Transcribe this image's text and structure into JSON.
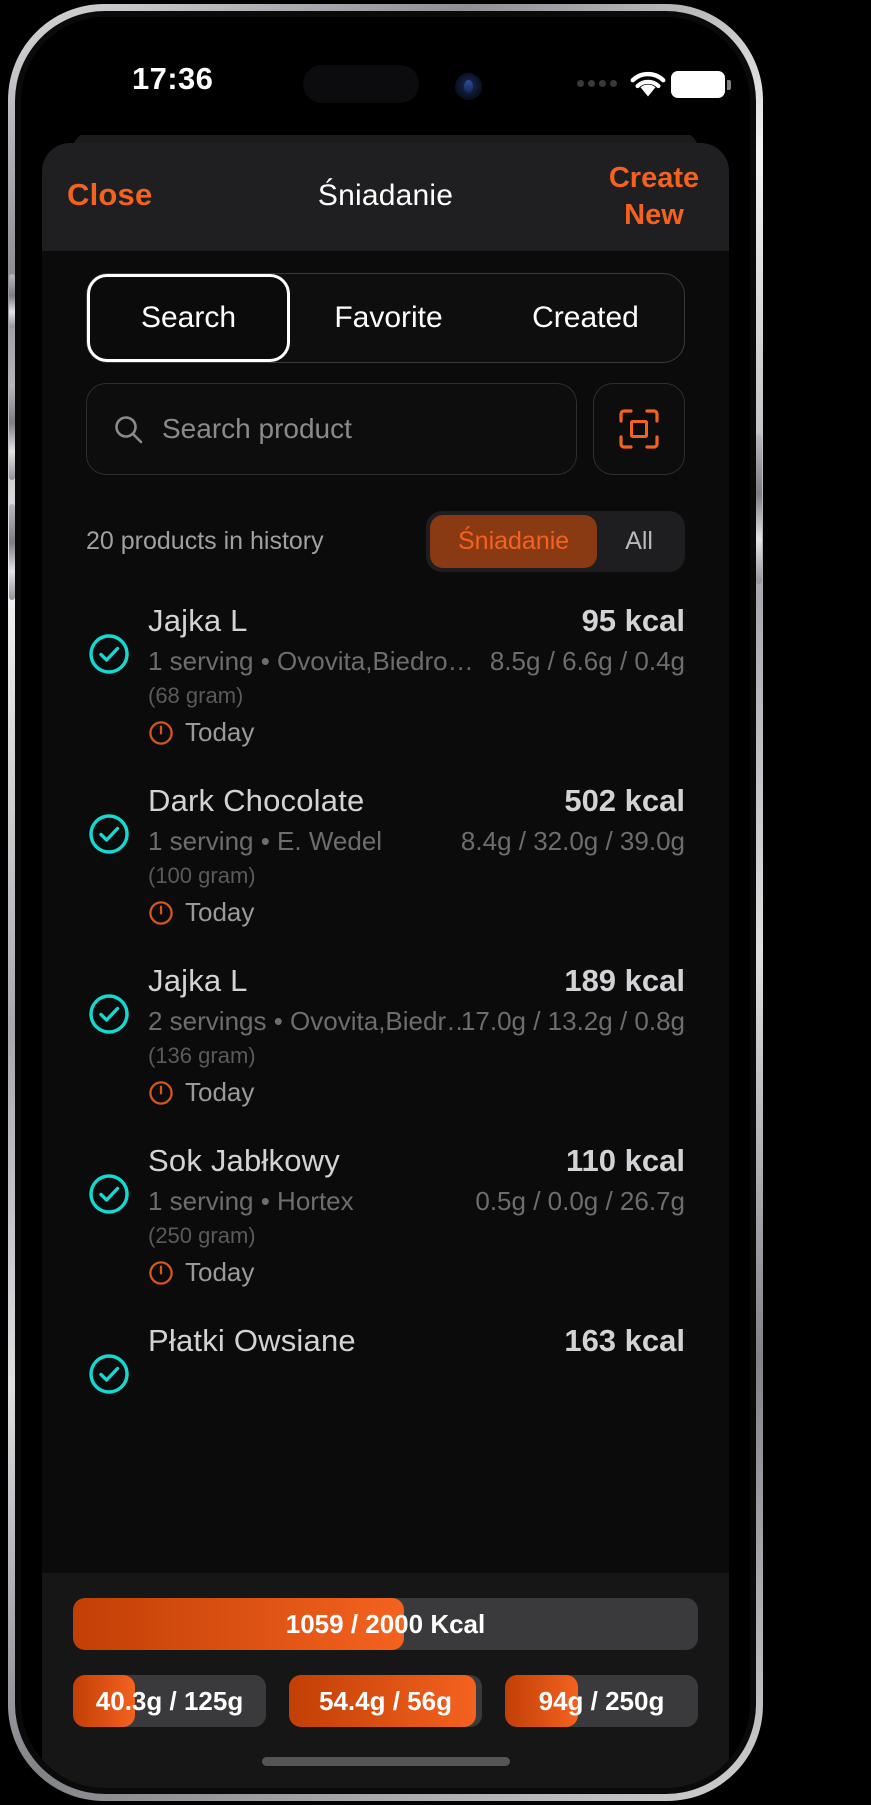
{
  "status_bar": {
    "time": "17:36",
    "cellular_icon": "cellular-dots-icon",
    "wifi_icon": "wifi-icon",
    "battery_icon": "battery-full-icon"
  },
  "header": {
    "close_label": "Close",
    "title": "Śniadanie",
    "create_new_line1": "Create",
    "create_new_line2": "New"
  },
  "tabs": [
    {
      "label": "Search",
      "active": true
    },
    {
      "label": "Favorite",
      "active": false
    },
    {
      "label": "Created",
      "active": false
    }
  ],
  "search": {
    "placeholder": "Search product",
    "value": "",
    "search_icon": "search-icon",
    "scan_icon": "barcode-scan-icon"
  },
  "history": {
    "count_label": "20 products in history",
    "filters": [
      {
        "label": "Śniadanie",
        "active": true
      },
      {
        "label": "All",
        "active": false
      }
    ]
  },
  "products": [
    {
      "name": "Jajka L",
      "kcal": "95 kcal",
      "serving": "1 serving • Ovovita,Biedro…",
      "macros": "8.5g / 6.6g / 0.4g",
      "gram": "(68 gram)",
      "date": "Today",
      "checked": true
    },
    {
      "name": "Dark Chocolate",
      "kcal": "502 kcal",
      "serving": "1 serving • E. Wedel",
      "macros": "8.4g / 32.0g / 39.0g",
      "gram": "(100 gram)",
      "date": "Today",
      "checked": true
    },
    {
      "name": "Jajka L",
      "kcal": "189 kcal",
      "serving": "2 servings • Ovovita,Biedr…",
      "macros": "17.0g / 13.2g / 0.8g",
      "gram": "(136 gram)",
      "date": "Today",
      "checked": true
    },
    {
      "name": "Sok Jabłkowy",
      "kcal": "110 kcal",
      "serving": "1 serving • Hortex",
      "macros": "0.5g / 0.0g / 26.7g",
      "gram": "(250 gram)",
      "date": "Today",
      "checked": true
    },
    {
      "name": "Płatki Owsiane",
      "kcal": "163 kcal",
      "serving": "",
      "macros": "",
      "gram": "",
      "date": "",
      "checked": true
    }
  ],
  "summary": {
    "calories": {
      "label": "1059 / 2000 Kcal",
      "current": 1059,
      "goal": 2000,
      "percent": 53
    },
    "macros": [
      {
        "label": "40.3g / 125g",
        "current": 40.3,
        "goal": 125,
        "percent": 32
      },
      {
        "label": "54.4g / 56g",
        "current": 54.4,
        "goal": 56,
        "percent": 97
      },
      {
        "label": "94g / 250g",
        "current": 94,
        "goal": 250,
        "percent": 38
      }
    ]
  },
  "colors": {
    "accent": "#f4621f",
    "accent_dark": "#c23f06",
    "check": "#14d9d0",
    "pill_bg": "#8a3a12",
    "track": "#3a3a3c"
  }
}
